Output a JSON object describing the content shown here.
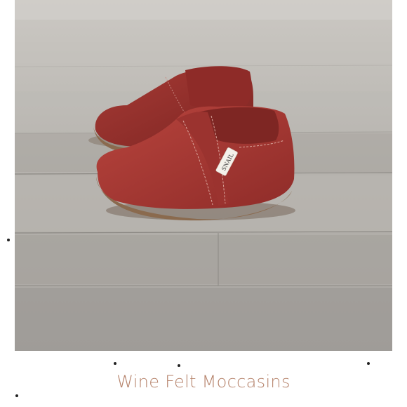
{
  "product": {
    "caption": "Wine Felt Moccasins",
    "tag_text": "SNAIL",
    "colors": {
      "caption": "#b5826a",
      "felt": "#a83a35",
      "felt_dark": "#7e2623",
      "sole": "#8a6a4e",
      "floor": "#b7b4af"
    }
  }
}
